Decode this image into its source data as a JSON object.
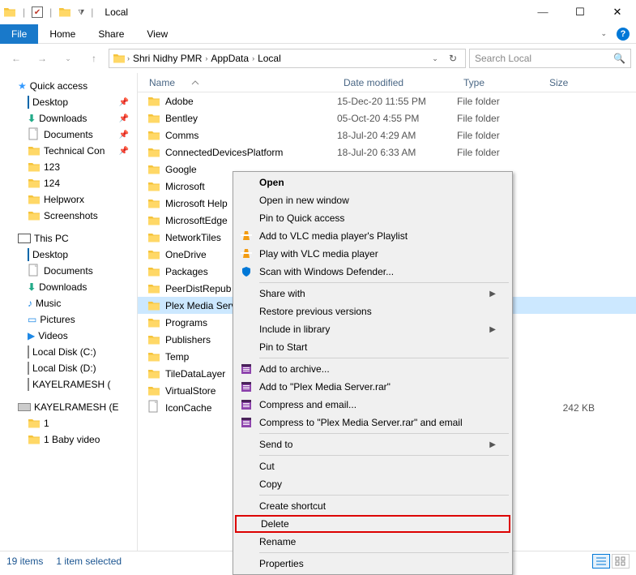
{
  "window": {
    "title": "Local"
  },
  "ribbon": {
    "file": "File",
    "tabs": [
      "Home",
      "Share",
      "View"
    ]
  },
  "addr": {
    "segs": [
      "Shri Nidhy PMR",
      "AppData",
      "Local"
    ]
  },
  "search": {
    "placeholder": "Search Local"
  },
  "navtree": {
    "quickaccess": "Quick access",
    "qa_items": [
      {
        "label": "Desktop",
        "pinned": true,
        "icon": "desktop"
      },
      {
        "label": "Downloads",
        "pinned": true,
        "icon": "downloads"
      },
      {
        "label": "Documents",
        "pinned": true,
        "icon": "documents"
      },
      {
        "label": "Technical Con",
        "pinned": true,
        "icon": "folder"
      },
      {
        "label": "123",
        "pinned": false,
        "icon": "folder"
      },
      {
        "label": "124",
        "pinned": false,
        "icon": "folder"
      },
      {
        "label": "Helpworx",
        "pinned": false,
        "icon": "folder"
      },
      {
        "label": "Screenshots",
        "pinned": false,
        "icon": "folder"
      }
    ],
    "thispc": "This PC",
    "pc_items": [
      {
        "label": "Desktop",
        "icon": "desktop"
      },
      {
        "label": "Documents",
        "icon": "documents"
      },
      {
        "label": "Downloads",
        "icon": "downloads"
      },
      {
        "label": "Music",
        "icon": "music"
      },
      {
        "label": "Pictures",
        "icon": "pictures"
      },
      {
        "label": "Videos",
        "icon": "videos"
      },
      {
        "label": "Local Disk (C:)",
        "icon": "drive"
      },
      {
        "label": "Local Disk (D:)",
        "icon": "drive"
      },
      {
        "label": "KAYELRAMESH (",
        "icon": "drive"
      }
    ],
    "ext_drive": "KAYELRAMESH (E",
    "ext_items": [
      {
        "label": "1",
        "icon": "folder"
      },
      {
        "label": "1 Baby video",
        "icon": "folder"
      }
    ]
  },
  "cols": {
    "name": "Name",
    "date": "Date modified",
    "type": "Type",
    "size": "Size"
  },
  "rows": [
    {
      "name": "Adobe",
      "date": "15-Dec-20 11:55 PM",
      "type": "File folder",
      "size": "",
      "icon": "folder"
    },
    {
      "name": "Bentley",
      "date": "05-Oct-20 4:55 PM",
      "type": "File folder",
      "size": "",
      "icon": "folder"
    },
    {
      "name": "Comms",
      "date": "18-Jul-20 4:29 AM",
      "type": "File folder",
      "size": "",
      "icon": "folder"
    },
    {
      "name": "ConnectedDevicesPlatform",
      "date": "18-Jul-20 6:33 AM",
      "type": "File folder",
      "size": "",
      "icon": "folder"
    },
    {
      "name": "Google",
      "date": "",
      "type": "",
      "size": "",
      "icon": "folder"
    },
    {
      "name": "Microsoft",
      "date": "",
      "type": "",
      "size": "",
      "icon": "folder"
    },
    {
      "name": "Microsoft Help",
      "date": "",
      "type": "",
      "size": "",
      "icon": "folder"
    },
    {
      "name": "MicrosoftEdge",
      "date": "",
      "type": "",
      "size": "",
      "icon": "folder"
    },
    {
      "name": "NetworkTiles",
      "date": "",
      "type": "",
      "size": "",
      "icon": "folder"
    },
    {
      "name": "OneDrive",
      "date": "",
      "type": "",
      "size": "",
      "icon": "folder"
    },
    {
      "name": "Packages",
      "date": "",
      "type": "",
      "size": "",
      "icon": "folder"
    },
    {
      "name": "PeerDistRepub",
      "date": "",
      "type": "",
      "size": "",
      "icon": "folder"
    },
    {
      "name": "Plex Media Server",
      "date": "",
      "type": "",
      "size": "",
      "icon": "folder",
      "selected": true
    },
    {
      "name": "Programs",
      "date": "",
      "type": "",
      "size": "",
      "icon": "folder"
    },
    {
      "name": "Publishers",
      "date": "",
      "type": "",
      "size": "",
      "icon": "folder"
    },
    {
      "name": "Temp",
      "date": "",
      "type": "",
      "size": "",
      "icon": "folder"
    },
    {
      "name": "TileDataLayer",
      "date": "",
      "type": "",
      "size": "",
      "icon": "folder"
    },
    {
      "name": "VirtualStore",
      "date": "",
      "type": "",
      "size": "",
      "icon": "folder"
    },
    {
      "name": "IconCache",
      "date": "",
      "type": "",
      "size": "242 KB",
      "icon": "file"
    }
  ],
  "status": {
    "count": "19 items",
    "selected": "1 item selected"
  },
  "ctx": {
    "open": "Open",
    "open_new": "Open in new window",
    "pin_qa": "Pin to Quick access",
    "vlc_playlist": "Add to VLC media player's Playlist",
    "vlc_play": "Play with VLC media player",
    "defender": "Scan with Windows Defender...",
    "share_with": "Share with",
    "restore": "Restore previous versions",
    "library": "Include in library",
    "pin_start": "Pin to Start",
    "archive": "Add to archive...",
    "rar_target": "Add to \"Plex Media Server.rar\"",
    "compress_email": "Compress and email...",
    "compress_rar_email": "Compress to \"Plex Media Server.rar\" and email",
    "send_to": "Send to",
    "cut": "Cut",
    "copy": "Copy",
    "shortcut": "Create shortcut",
    "delete": "Delete",
    "rename": "Rename",
    "properties": "Properties"
  }
}
